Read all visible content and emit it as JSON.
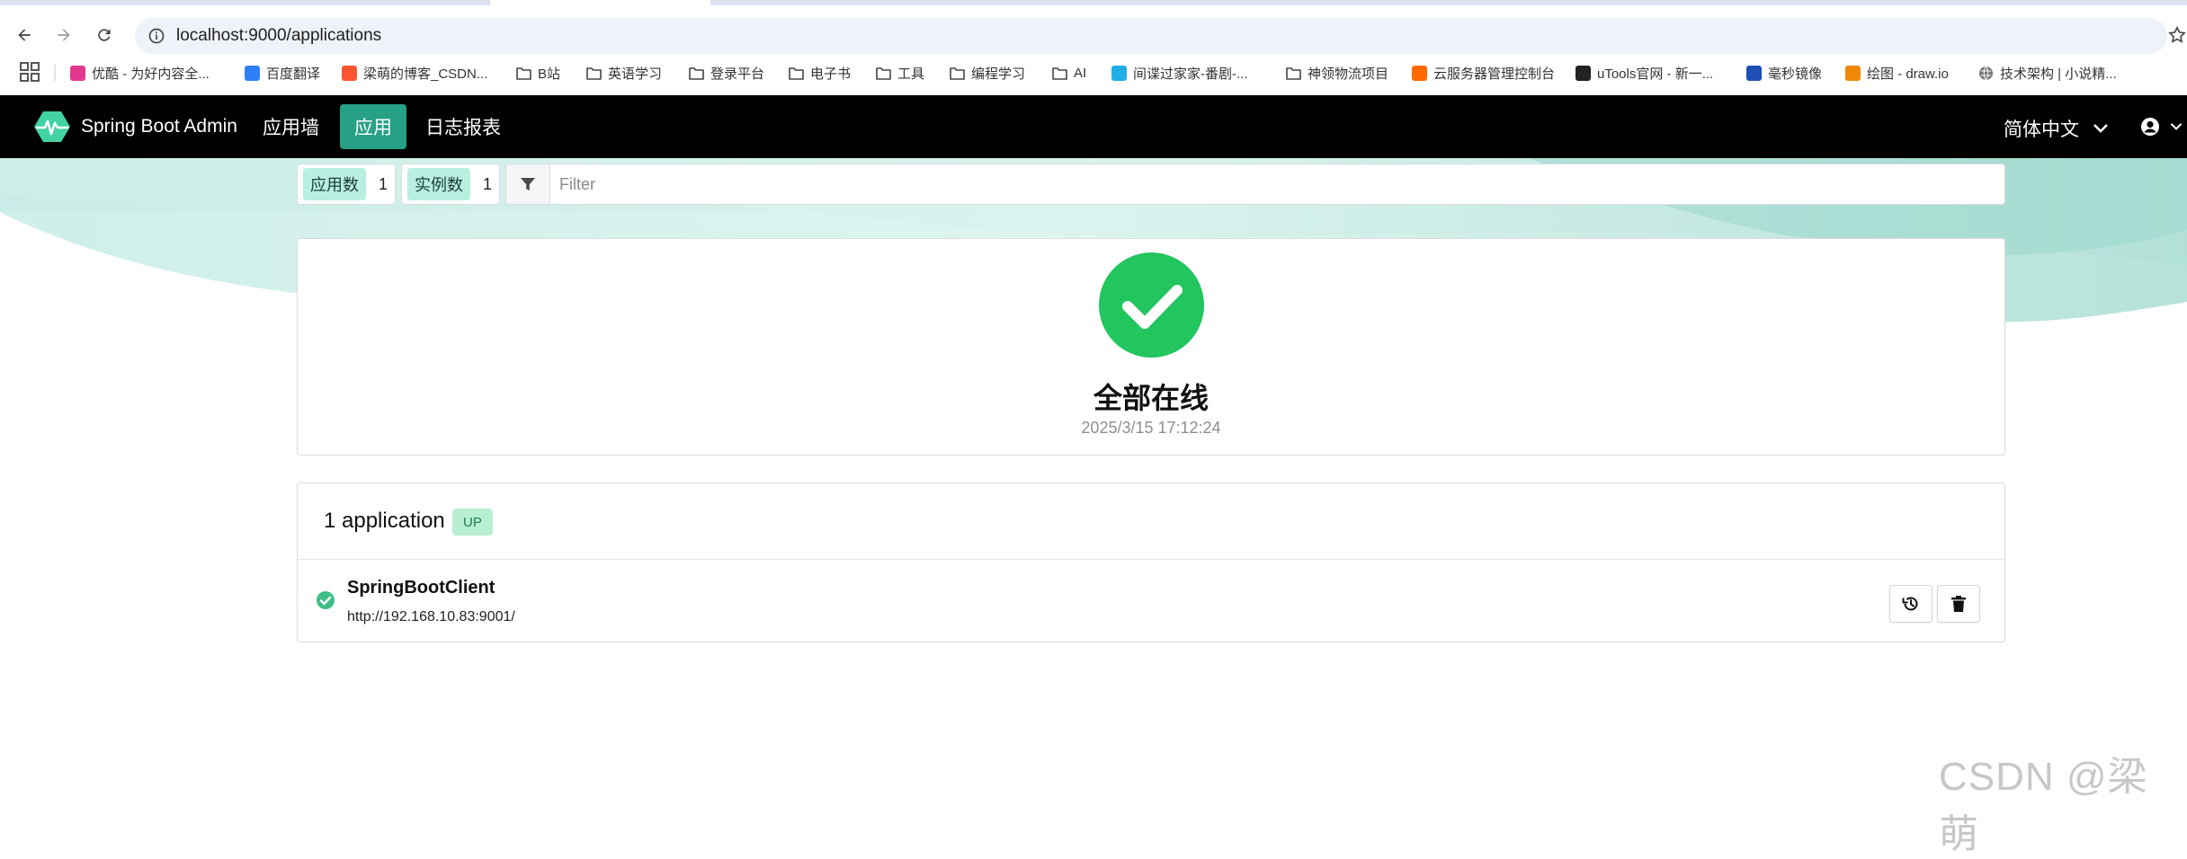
{
  "browser": {
    "url": "localhost:9000/applications",
    "bookmarks": [
      {
        "label": "优酷 - 为好内容全...",
        "icon": "youku-icon",
        "color": "#e4378e"
      },
      {
        "label": "百度翻译",
        "icon": "baidu-translate-icon",
        "color": "#2f7ff7"
      },
      {
        "label": "梁萌的博客_CSDN...",
        "icon": "csdn-icon",
        "color": "#fc5531"
      },
      {
        "label": "B站",
        "icon": "folder-icon"
      },
      {
        "label": "英语学习",
        "icon": "folder-icon"
      },
      {
        "label": "登录平台",
        "icon": "folder-icon"
      },
      {
        "label": "电子书",
        "icon": "folder-icon"
      },
      {
        "label": "工具",
        "icon": "folder-icon"
      },
      {
        "label": "编程学习",
        "icon": "folder-icon"
      },
      {
        "label": "AI",
        "icon": "folder-icon"
      },
      {
        "label": "间谍过家家-番剧-...",
        "icon": "bilibili-icon",
        "color": "#23ade5"
      },
      {
        "label": "神领物流项目",
        "icon": "folder-icon"
      },
      {
        "label": "云服务器管理控制台",
        "icon": "aliyun-icon",
        "color": "#ff6a00"
      },
      {
        "label": "uTools官网 - 新一...",
        "icon": "utools-icon",
        "color": "#222222"
      },
      {
        "label": "毫秒镜像",
        "icon": "millisecond-mirror-icon",
        "color": "#1f4fb5"
      },
      {
        "label": "绘图 - draw.io",
        "icon": "drawio-icon",
        "color": "#f08705"
      },
      {
        "label": "技术架构 | 小说精...",
        "icon": "globe-icon",
        "color": "#666666"
      }
    ]
  },
  "navbar": {
    "brand": "Spring Boot Admin",
    "items": [
      {
        "label": "应用墙",
        "active": false
      },
      {
        "label": "应用",
        "active": true
      },
      {
        "label": "日志报表",
        "active": false
      }
    ],
    "language": "简体中文"
  },
  "filterbar": {
    "app_count_label": "应用数",
    "app_count": "1",
    "instance_count_label": "实例数",
    "instance_count": "1",
    "filter_placeholder": "Filter"
  },
  "status": {
    "title": "全部在线",
    "timestamp": "2025/3/15 17:12:24"
  },
  "applications": {
    "summary": "1 application",
    "badge": "UP",
    "items": [
      {
        "name": "SpringBootClient",
        "url": "http://192.168.10.83:9001/",
        "status": "UP"
      }
    ]
  },
  "watermark": "CSDN @梁萌",
  "colors": {
    "navbar_bg": "#000000",
    "accent": "#26a186",
    "status_green": "#22c55e",
    "wave": "#cdeee8"
  }
}
